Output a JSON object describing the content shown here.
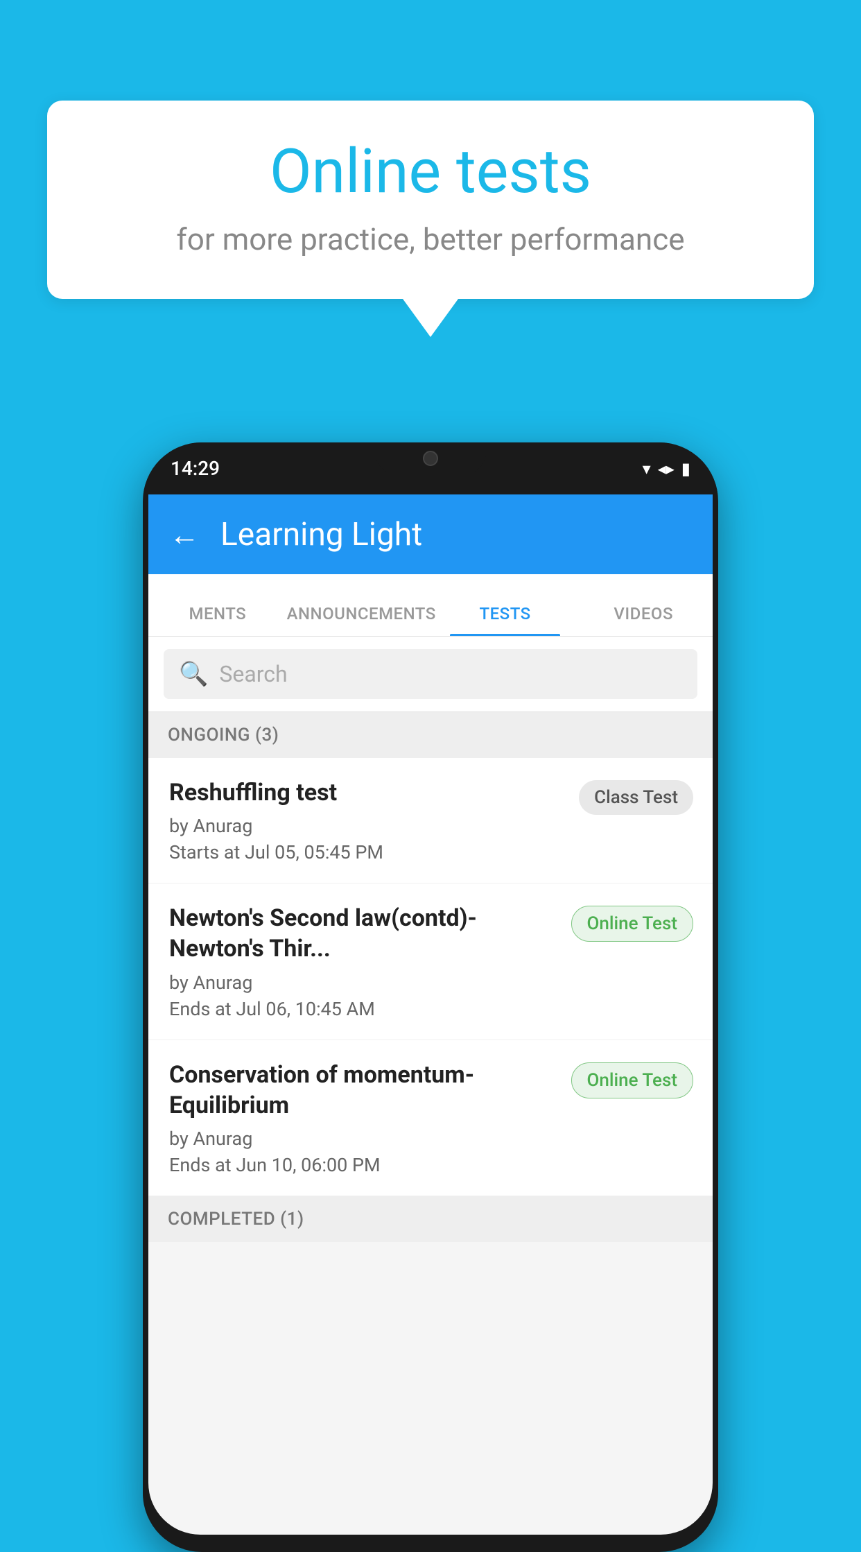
{
  "background_color": "#1BB8E8",
  "speech_bubble": {
    "title": "Online tests",
    "subtitle": "for more practice, better performance"
  },
  "phone": {
    "status_bar": {
      "time": "14:29",
      "icons": [
        "wifi",
        "signal",
        "battery"
      ]
    },
    "app_bar": {
      "title": "Learning Light",
      "back_label": "←"
    },
    "tabs": [
      {
        "label": "MENTS",
        "active": false
      },
      {
        "label": "ANNOUNCEMENTS",
        "active": false
      },
      {
        "label": "TESTS",
        "active": true
      },
      {
        "label": "VIDEOS",
        "active": false
      }
    ],
    "search": {
      "placeholder": "Search"
    },
    "ongoing_section": {
      "label": "ONGOING (3)"
    },
    "tests": [
      {
        "title": "Reshuffling test",
        "author": "by Anurag",
        "time_label": "Starts at",
        "time": "Jul 05, 05:45 PM",
        "badge": "Class Test",
        "badge_type": "class"
      },
      {
        "title": "Newton's Second law(contd)-Newton's Thir...",
        "author": "by Anurag",
        "time_label": "Ends at",
        "time": "Jul 06, 10:45 AM",
        "badge": "Online Test",
        "badge_type": "online"
      },
      {
        "title": "Conservation of momentum-Equilibrium",
        "author": "by Anurag",
        "time_label": "Ends at",
        "time": "Jun 10, 06:00 PM",
        "badge": "Online Test",
        "badge_type": "online"
      }
    ],
    "completed_section": {
      "label": "COMPLETED (1)"
    }
  }
}
